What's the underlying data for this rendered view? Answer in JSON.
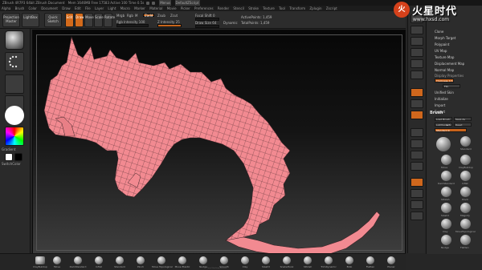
{
  "titlebar": {
    "app_name": "ZBrush 4R7P3",
    "info": "ZBrush 4R7P3 64bit  ZBrush Document",
    "stats": "Mem 1646MB  Free 17583  Active 100  Time 0.5s",
    "items": [
      "Menus",
      "DefaultZScript",
      "Q A S",
      "Q",
      "6"
    ]
  },
  "menu": {
    "items": [
      "Alpha",
      "Brush",
      "Color",
      "Document",
      "Draw",
      "Edit",
      "File",
      "Layer",
      "Light",
      "Macro",
      "Marker",
      "Material",
      "Movie",
      "Picker",
      "Preferences",
      "Render",
      "Stencil",
      "Stroke",
      "Texture",
      "Tool",
      "Transform",
      "Zplugin",
      "Zscript"
    ]
  },
  "shelf": {
    "projection_master": "Projection\nMaster",
    "lightbox": "LightBox",
    "quick_sketch": "Quick\nSketch",
    "edit": "Edit",
    "draw": "Draw",
    "move": "Move",
    "scale": "Scale",
    "rotate": "Rotate",
    "mrgb": "Mrgb",
    "rgb": "Rgb",
    "m": "M",
    "zadd": "Zadd",
    "zsub": "Zsub",
    "zcut": "Zcut",
    "rgb_intensity": "Rgb Intensity 100",
    "z_intensity": "Z Intensity 25",
    "focal_shift": "Focal Shift 0",
    "draw_size": "Draw Size 64",
    "dynamic": "Dynamic",
    "active_points": "ActivePoints: 1,459",
    "total_points": "TotalPoints: 1,459"
  },
  "left_tray": {
    "gradient_label": "Gradient",
    "switch_color_label": "SwitchColor"
  },
  "tool_palette": {
    "items": [
      "Clone",
      "Morph Target",
      "Polypaint",
      "UV Map",
      "Texture Map",
      "Displacement Map",
      "Normal Map",
      "Display Properties",
      "Unified Skin",
      "Initialize",
      "Import",
      "Export"
    ],
    "display_field": "Thickness 0.5",
    "display_sub": "Flip"
  },
  "brush_palette": {
    "title": "Brush",
    "load_brush": "Load Brush",
    "save_as": "Save As",
    "lightbox_brushes": "Lightbox▶Brushes",
    "reset": "Reset",
    "current_brush": "Standard  R",
    "brushes": [
      "Standard",
      "Move",
      "ClayBuildup",
      "DamStandard",
      "Inflat",
      "hPolish",
      "Pinch",
      "Slash3",
      "Magnify",
      "Clay",
      "MoveTopological",
      "Nudge",
      "Flatten",
      "Smooth",
      "TrimDynamic",
      "SnakeHook",
      "Layer",
      "Planar",
      "Blob",
      "ZProject",
      "Mask"
    ]
  },
  "bottom_shelf": {
    "brushes": [
      "ClayBuildup",
      "Move",
      "DamStandard",
      "Inflat",
      "Standard",
      "Pinch",
      "Move Topological",
      "Move Elastic",
      "Nudge",
      "Smooth",
      "Clay",
      "Slash3",
      "SnakeHook",
      "hPolish",
      "TrimDynamic",
      "Blob",
      "Flatten",
      "Planar"
    ],
    "status": "CurveTubeSnap  Maskline"
  },
  "watermark": {
    "brand_cn": "火星时代",
    "url": "www.hxsd.com",
    "logo_char": "火"
  },
  "colors": {
    "accent": "#d36a1b",
    "model": "#f28a91",
    "wire": "#3a2226",
    "background_dark": "#262626"
  }
}
